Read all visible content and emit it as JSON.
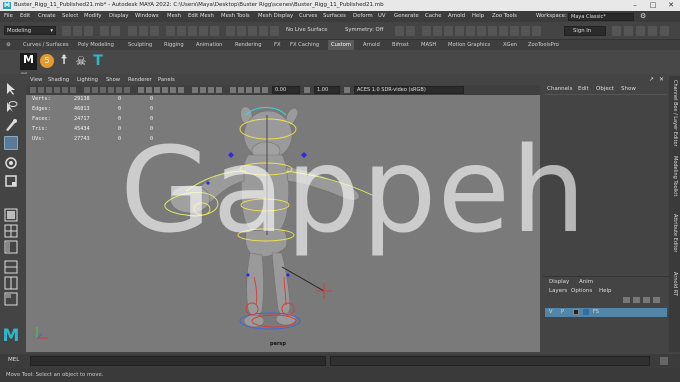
{
  "window": {
    "title": "Buster_Rigg_11_Published21.mb* - Autodesk MAYA 2022: C:\\Users\\Maya\\Desktop\\Buster Rigg\\scenes\\Buster_Rigg_11_Published21.mb"
  },
  "menubar": {
    "items": [
      "File",
      "Edit",
      "Create",
      "Select",
      "Modify",
      "Display",
      "Windows",
      "Mesh",
      "Edit Mesh",
      "Mesh Tools",
      "Mesh Display",
      "Curves",
      "Surfaces",
      "Deform",
      "UV",
      "Generate",
      "Cache",
      "Arnold",
      "Help",
      "Zoo Tools"
    ],
    "workspace_label": "Workspace:",
    "workspace_value": "Maya Classic*"
  },
  "statusline": {
    "menuset": "Modeling",
    "live_surface": "No Live Surface",
    "symmetry": "Symmetry: Off",
    "signin": "Sign In"
  },
  "shelf": {
    "tabs": [
      "Curves / Surfaces",
      "Poly Modeling",
      "Sculpting",
      "Rigging",
      "Animation",
      "Rendering",
      "FX",
      "FX Caching",
      "Custom",
      "Arnold",
      "Bifrost",
      "MASH",
      "Motion Graphics",
      "XGen",
      "ZooToolsPro"
    ],
    "active_tab": "Custom"
  },
  "viewport": {
    "menu": [
      "View",
      "Shading",
      "Lighting",
      "Show",
      "Renderer",
      "Panels"
    ],
    "field1": "0.00",
    "field2": "1.00",
    "colorspace": "ACES 1.0 SDR-video (sRGB)",
    "camera": "persp",
    "hud": [
      {
        "label": "Verts:",
        "v1": "29138",
        "v2": "0",
        "v3": "0"
      },
      {
        "label": "Edges:",
        "v1": "46813",
        "v2": "0",
        "v3": "0"
      },
      {
        "label": "Faces:",
        "v1": "24717",
        "v2": "0",
        "v3": "0"
      },
      {
        "label": "Tris:",
        "v1": "45434",
        "v2": "0",
        "v3": "0"
      },
      {
        "label": "UVs:",
        "v1": "27743",
        "v2": "0",
        "v3": "0"
      }
    ]
  },
  "channelbox": {
    "menu": [
      "Channels",
      "Edit",
      "Object",
      "Show"
    ]
  },
  "layers": {
    "tabs": [
      "Display",
      "Anim"
    ],
    "menu": [
      "Layers",
      "Options",
      "Help"
    ],
    "row_v": "V",
    "row_p": "P",
    "row_name": "FS"
  },
  "sidetabs": [
    "Channel Box / Layer Editor",
    "Modeling Toolkit",
    "Attribute Editor",
    "Arnold RT"
  ],
  "bottom": {
    "mel_label": "MEL",
    "help_text": "Move Tool: Select an object to move."
  },
  "watermark": "Gappeh",
  "colors": {
    "accent_blue": "#2b6ea8",
    "maya_teal": "#27a6b8",
    "viewport_bg": "#7a7a7a"
  }
}
